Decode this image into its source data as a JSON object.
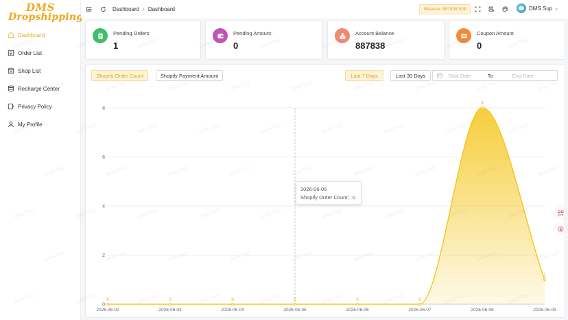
{
  "brand": {
    "line1": "DMS",
    "line2": "Dropshipping"
  },
  "sidebar": {
    "items": [
      {
        "label": "Dashboard",
        "icon": "home-icon",
        "active": true
      },
      {
        "label": "Order List",
        "icon": "document-icon",
        "active": false
      },
      {
        "label": "Shop List",
        "icon": "store-icon",
        "active": false
      },
      {
        "label": "Recharge Center",
        "icon": "database-icon",
        "active": false
      },
      {
        "label": "Privacy Policy",
        "icon": "policy-icon",
        "active": false
      },
      {
        "label": "My Profile",
        "icon": "user-icon",
        "active": false
      }
    ]
  },
  "header": {
    "breadcrumb": [
      "Dashboard",
      "Dashboard"
    ],
    "balance": "Balance: 887838.00$",
    "user": "DMS Sup"
  },
  "cards": [
    {
      "label": "Pending Orders",
      "value": "1",
      "icon": "clipboard-icon",
      "color": "#3fbf6b"
    },
    {
      "label": "Pending Amount",
      "value": "0",
      "icon": "wallet-icon",
      "color": "#c352b8"
    },
    {
      "label": "Account Balance",
      "value": "887838",
      "icon": "money-bag-icon",
      "color": "#ef8a73"
    },
    {
      "label": "Coupon Amount",
      "value": "0",
      "icon": "coupon-icon",
      "color": "#f28a3c"
    }
  ],
  "chart_controls": {
    "metric_tabs": [
      "Shopify Order Count",
      "Shopify Payment Amount"
    ],
    "active_metric": "Shopify Order Count",
    "range_buttons": [
      "Last 7 Days",
      "Last 30 Days"
    ],
    "active_range": "Last 7 Days",
    "start_placeholder": "Start Date",
    "to_label": "To",
    "end_placeholder": "End Date"
  },
  "tooltip": {
    "date": "2026-06-05",
    "line": "Shopify Order Count：0"
  },
  "watermark": "DMS Sup",
  "colors": {
    "accent": "#f2a71b",
    "series": "#f5c518"
  },
  "chart_data": {
    "type": "area",
    "x": [
      "2026-06-02",
      "2026-06-03",
      "2026-06-04",
      "2026-06-05",
      "2026-06-06",
      "2026-06-07",
      "2026-06-08",
      "2026-06-09"
    ],
    "series": [
      {
        "name": "Shopify Order Count",
        "values": [
          0,
          0,
          0,
          0,
          0,
          0,
          8,
          1
        ]
      }
    ],
    "yticks": [
      0,
      2,
      4,
      6,
      8
    ],
    "ylim": [
      0,
      8
    ],
    "grid": true,
    "smooth": true,
    "data_labels": true
  }
}
